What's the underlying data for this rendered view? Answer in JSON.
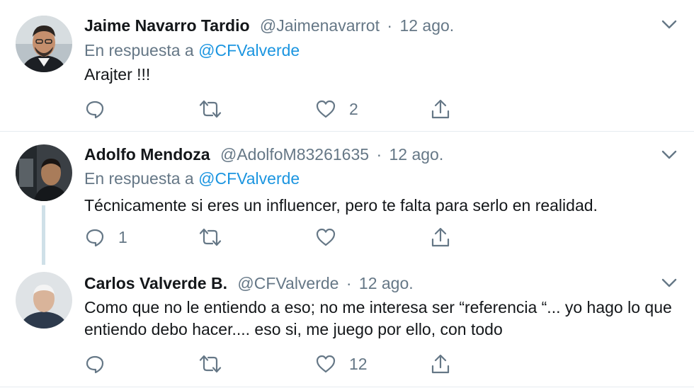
{
  "tweets": [
    {
      "name": "Jaime Navarro Tardio",
      "handle": "@Jaimenavarrot",
      "sep": "·",
      "date": "12 ago.",
      "reply_prefix": "En respuesta a",
      "reply_to": "@CFValverde",
      "text": "Arajter !!!",
      "reply_count": "",
      "retweet_count": "",
      "like_count": "2"
    },
    {
      "name": "Adolfo Mendoza",
      "handle": "@AdolfoM83261635",
      "sep": "·",
      "date": "12 ago.",
      "reply_prefix": "En respuesta a",
      "reply_to": "@CFValverde",
      "text": "Técnicamente si eres un influencer, pero te falta para serlo en realidad.",
      "reply_count": "1",
      "retweet_count": "",
      "like_count": ""
    },
    {
      "name": "Carlos Valverde B.",
      "handle": "@CFValverde",
      "sep": "·",
      "date": "12 ago.",
      "text": "Como que no le entiendo a eso; no me interesa ser “referencia “... yo hago lo que entiendo debo hacer.... eso si, me juego por ello, con todo",
      "reply_count": "",
      "retweet_count": "",
      "like_count": "12"
    }
  ],
  "icons": {
    "reply": "reply-icon",
    "retweet": "retweet-icon",
    "like": "heart-icon",
    "share": "share-icon",
    "menu": "chevron-down-icon"
  },
  "colors": {
    "text": "#14171a",
    "secondary": "#657786",
    "link": "#1b95e0",
    "divider": "#e6ecf0",
    "thread": "#cfe0e8"
  }
}
